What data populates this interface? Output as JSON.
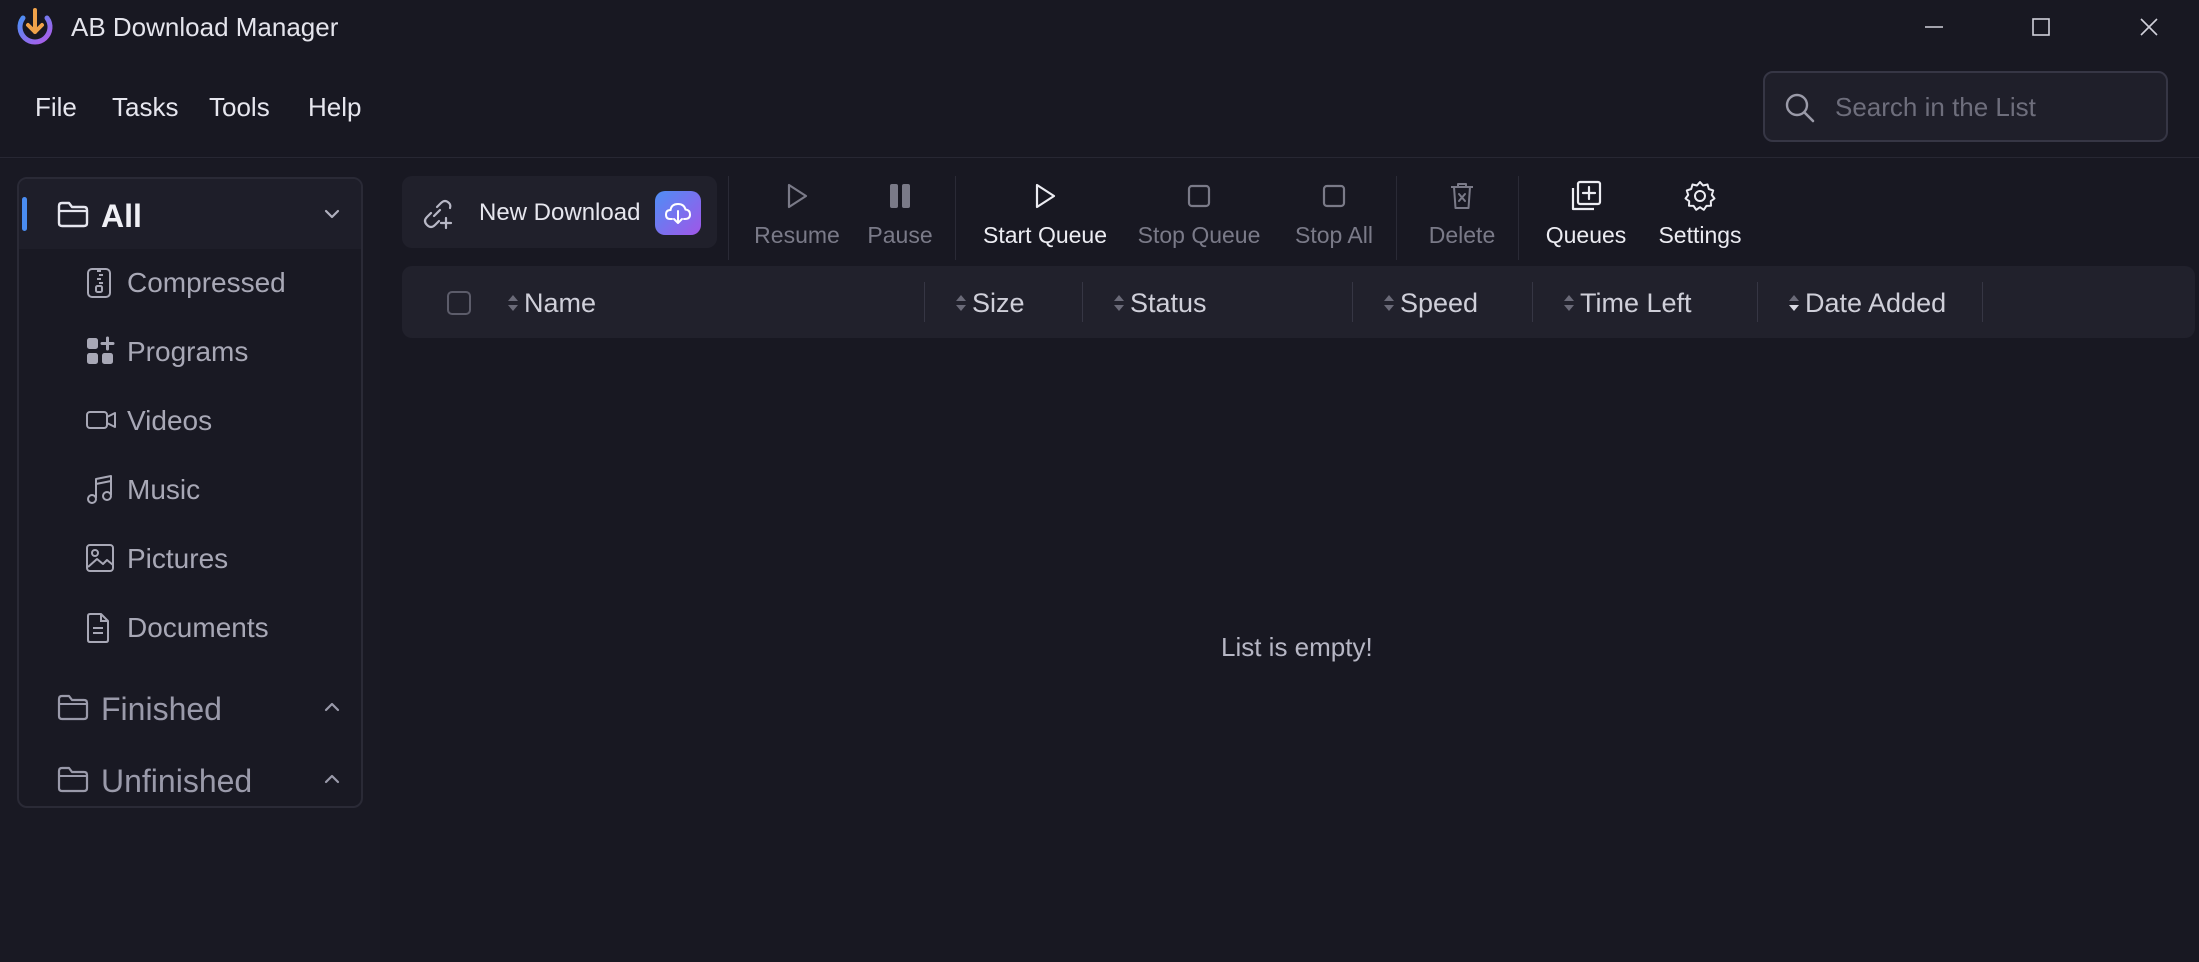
{
  "window": {
    "title": "AB Download Manager",
    "controls": [
      "minimize-icon",
      "maximize-icon",
      "close-icon"
    ]
  },
  "menu": {
    "file": "File",
    "tasks": "Tasks",
    "tools": "Tools",
    "help": "Help"
  },
  "search": {
    "placeholder": "Search in the List",
    "value": ""
  },
  "sidebar": {
    "all": {
      "label": "All",
      "icon": "folder-icon",
      "expanded": true
    },
    "subcategories": [
      {
        "label": "Compressed",
        "icon": "archive-icon"
      },
      {
        "label": "Programs",
        "icon": "apps-icon"
      },
      {
        "label": "Videos",
        "icon": "video-icon"
      },
      {
        "label": "Music",
        "icon": "music-icon"
      },
      {
        "label": "Pictures",
        "icon": "image-icon"
      },
      {
        "label": "Documents",
        "icon": "document-icon"
      }
    ],
    "finished": {
      "label": "Finished",
      "icon": "folder-icon",
      "expanded": false
    },
    "unfinished": {
      "label": "Unfinished",
      "icon": "folder-icon",
      "expanded": false
    }
  },
  "toolbar": {
    "new_download": "New Download",
    "resume": "Resume",
    "pause": "Pause",
    "start_queue": "Start Queue",
    "stop_queue": "Stop Queue",
    "stop_all": "Stop All",
    "delete": "Delete",
    "queues": "Queues",
    "settings": "Settings"
  },
  "table": {
    "columns": [
      "Name",
      "Size",
      "Status",
      "Speed",
      "Time Left",
      "Date Added"
    ],
    "rows": [],
    "empty_message": "List is empty!"
  },
  "colors": {
    "background": "#181822",
    "accent_blue": "#4a8cf0",
    "accent_purple": "#a056e8"
  }
}
